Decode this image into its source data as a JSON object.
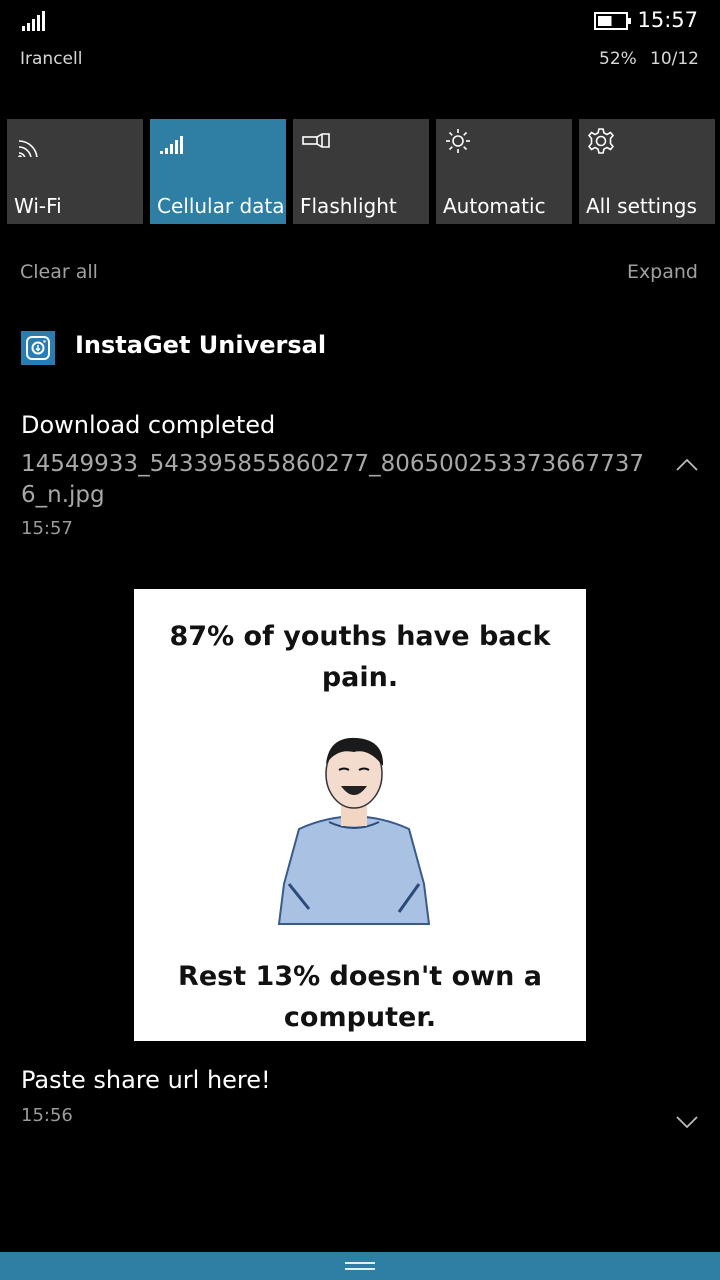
{
  "status_bar": {
    "carrier": "Irancell",
    "time": "15:57",
    "battery_percent": "52%",
    "date": "10/12",
    "battery_level": 0.52,
    "signal_icon": "signal-bars-icon",
    "battery_icon": "battery-icon"
  },
  "quick_actions": [
    {
      "label": "Wi-Fi",
      "icon": "wifi-icon",
      "active": false
    },
    {
      "label": "Cellular data",
      "icon": "cellular-icon",
      "active": true
    },
    {
      "label": "Flashlight",
      "icon": "flashlight-icon",
      "active": false
    },
    {
      "label": "Automatic",
      "icon": "brightness-icon",
      "active": false
    },
    {
      "label": "All settings",
      "icon": "gear-icon",
      "active": false
    }
  ],
  "actions": {
    "clear_all": "Clear all",
    "expand": "Expand"
  },
  "app": {
    "name": "InstaGet Universal",
    "icon": "instaget-app-icon"
  },
  "notifications": [
    {
      "title": "Download completed",
      "body": "14549933_543395855860277_8065002533736677376_n.jpg",
      "time": "15:57",
      "expanded": true,
      "image": {
        "top_text": "87% of youths have back pain.",
        "bottom_text": "Rest 13% doesn't own a computer."
      }
    },
    {
      "title": "Paste share url here!",
      "time": "15:56",
      "expanded": false
    }
  ],
  "colors": {
    "accent": "#2e7fa3",
    "tile": "#3a3a3a",
    "background": "#000000"
  }
}
